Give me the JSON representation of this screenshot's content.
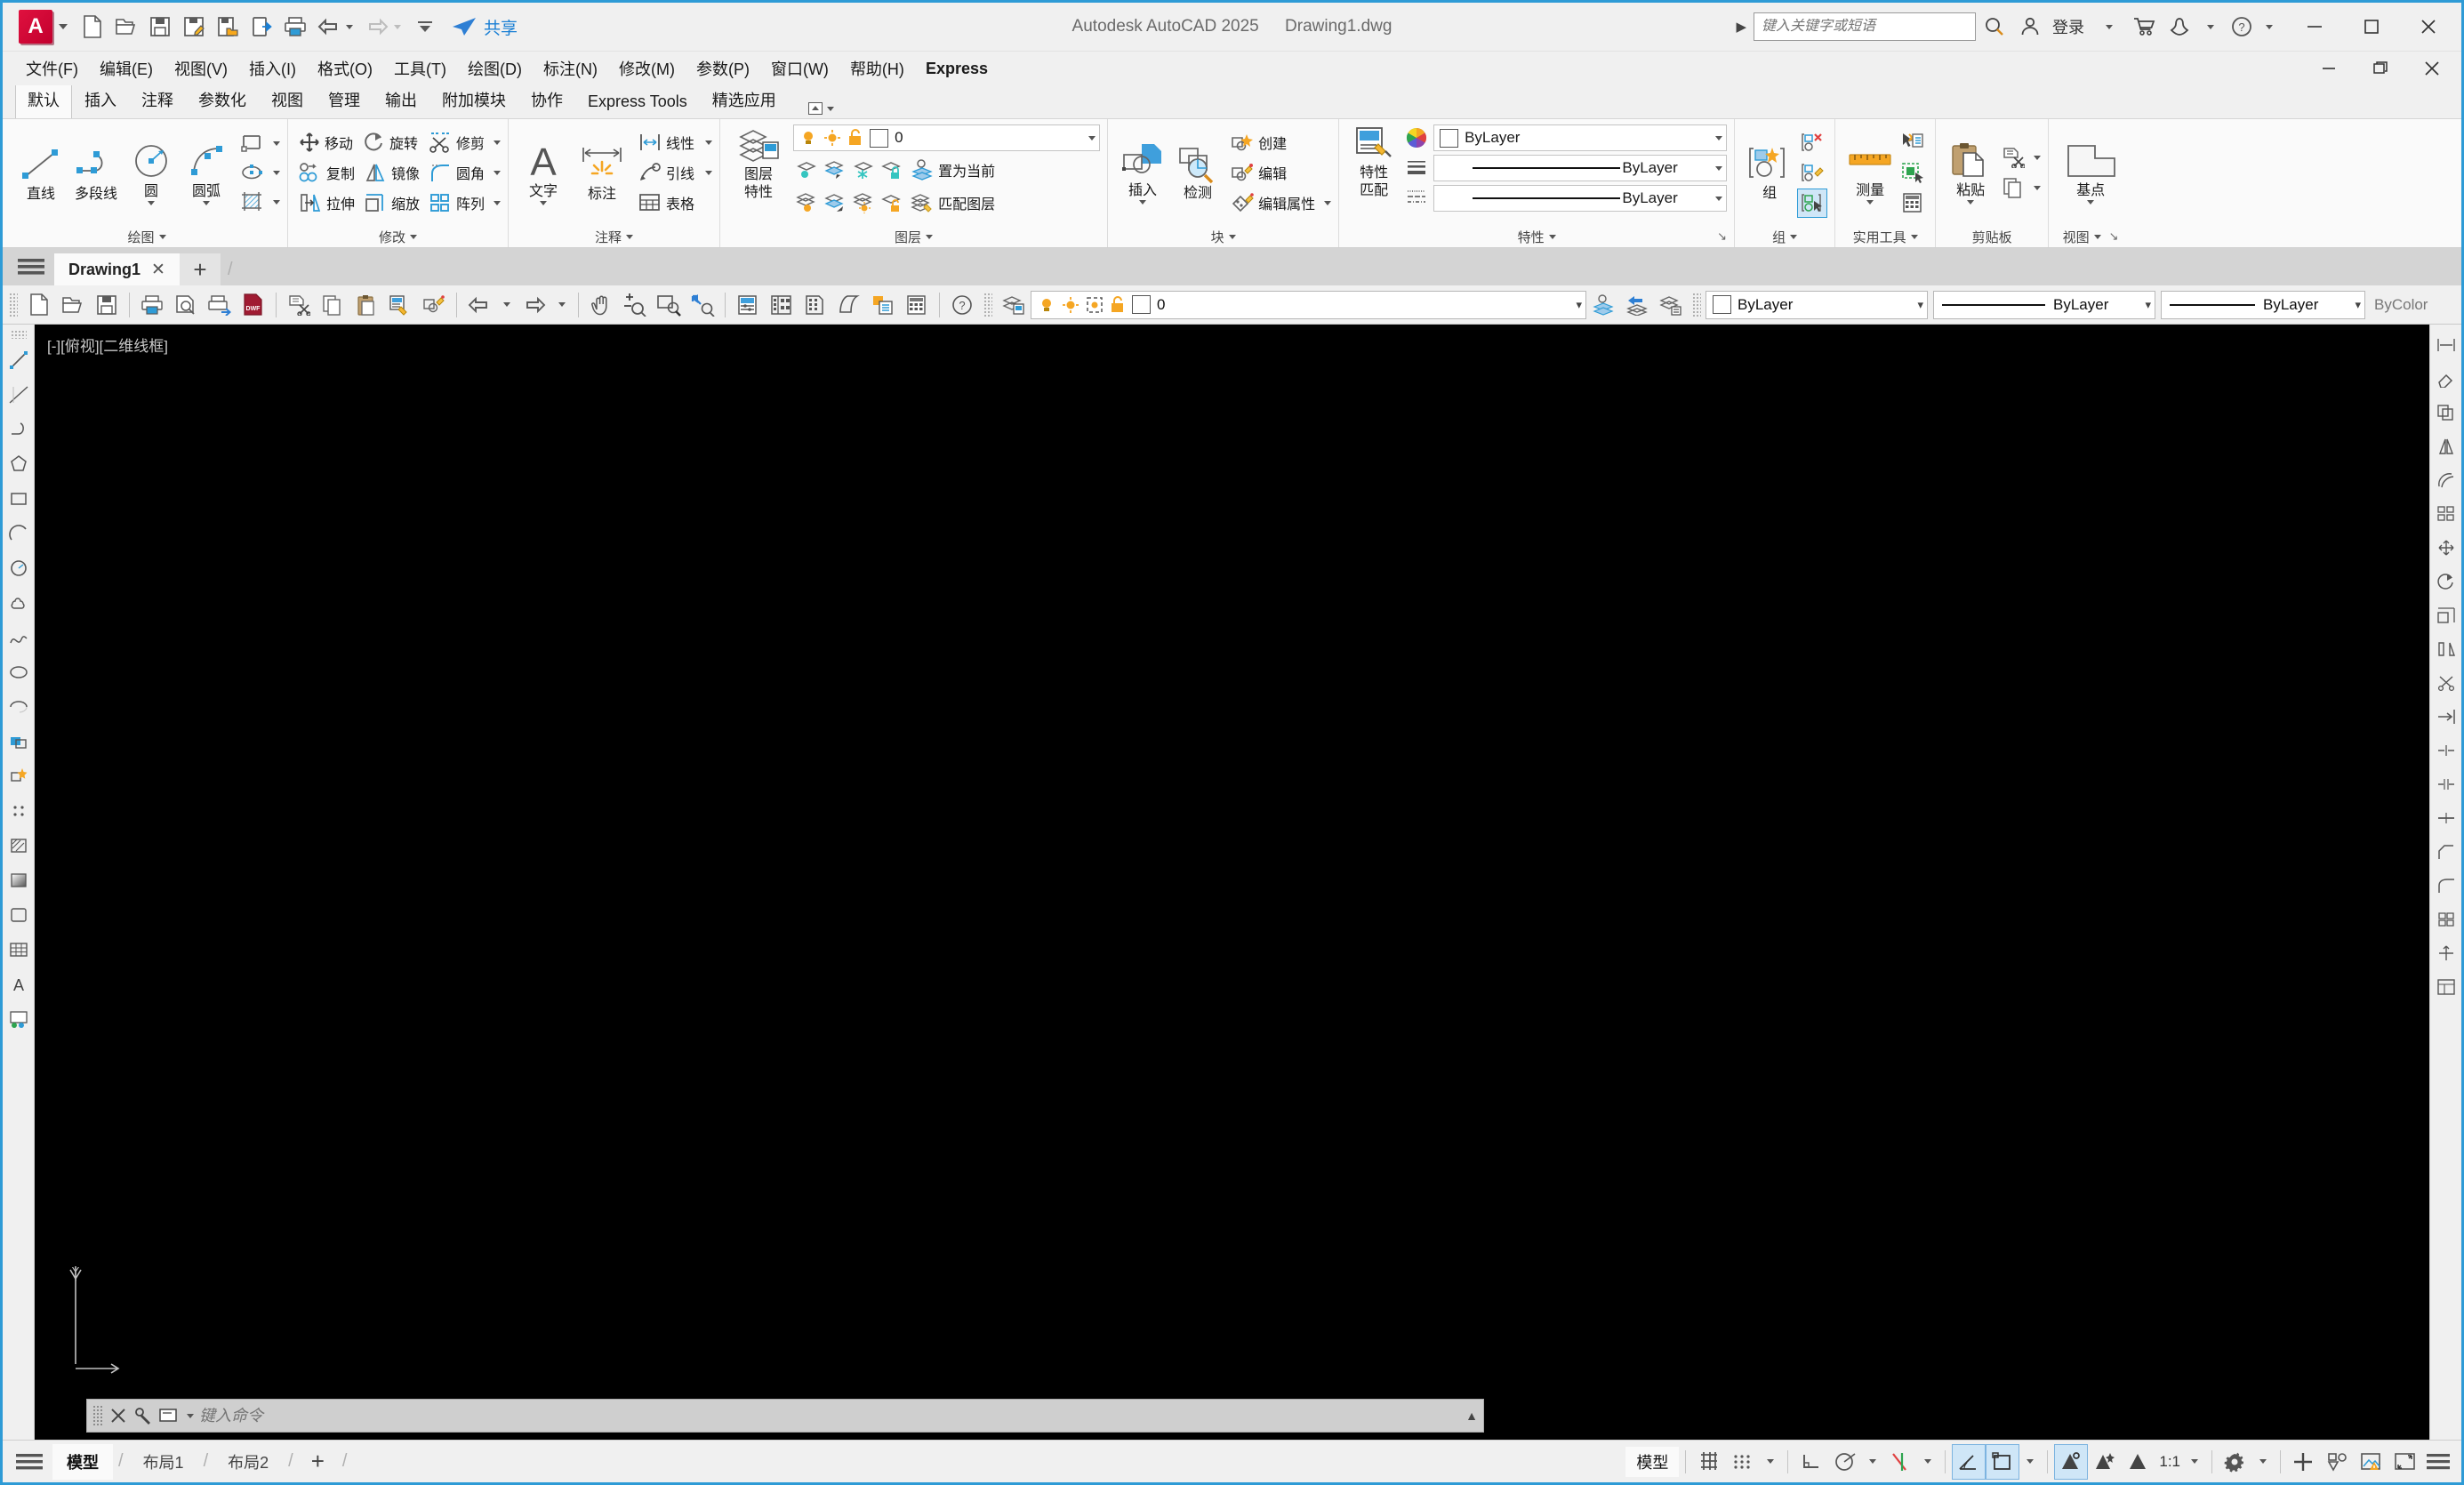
{
  "titlebar": {
    "app_logo": "A",
    "quick_access": [
      {
        "name": "new-file",
        "icon": "page"
      },
      {
        "name": "open-file",
        "icon": "folder-open"
      },
      {
        "name": "save",
        "icon": "save"
      },
      {
        "name": "save-as",
        "icon": "save-edit"
      },
      {
        "name": "save-to-cloud",
        "icon": "save-folder"
      },
      {
        "name": "export",
        "icon": "device-arrow"
      },
      {
        "name": "print",
        "icon": "printer"
      },
      {
        "name": "undo",
        "icon": "undo-arrow"
      },
      {
        "name": "redo",
        "icon": "redo-arrow"
      },
      {
        "name": "qat-dropdown",
        "icon": "bar-caret"
      }
    ],
    "share_label": "共享",
    "app_title": "Autodesk AutoCAD 2025",
    "file_name": "Drawing1.dwg",
    "search_placeholder": "键入关键字或短语",
    "signin_label": "登录",
    "window_buttons": [
      "minimize",
      "maximize",
      "close"
    ]
  },
  "menubar": {
    "items": [
      {
        "label": "文件(F)",
        "name": "menu-file"
      },
      {
        "label": "编辑(E)",
        "name": "menu-edit"
      },
      {
        "label": "视图(V)",
        "name": "menu-view"
      },
      {
        "label": "插入(I)",
        "name": "menu-insert"
      },
      {
        "label": "格式(O)",
        "name": "menu-format"
      },
      {
        "label": "工具(T)",
        "name": "menu-tools"
      },
      {
        "label": "绘图(D)",
        "name": "menu-draw"
      },
      {
        "label": "标注(N)",
        "name": "menu-dimension"
      },
      {
        "label": "修改(M)",
        "name": "menu-modify"
      },
      {
        "label": "参数(P)",
        "name": "menu-parametric"
      },
      {
        "label": "窗口(W)",
        "name": "menu-window"
      },
      {
        "label": "帮助(H)",
        "name": "menu-help"
      },
      {
        "label": "Express",
        "name": "menu-express"
      }
    ]
  },
  "ribbon_tabs": {
    "items": [
      {
        "label": "默认",
        "name": "ribbon-tab-home",
        "active": true
      },
      {
        "label": "插入",
        "name": "ribbon-tab-insert",
        "active": false
      },
      {
        "label": "注释",
        "name": "ribbon-tab-annotate",
        "active": false
      },
      {
        "label": "参数化",
        "name": "ribbon-tab-parametric",
        "active": false
      },
      {
        "label": "视图",
        "name": "ribbon-tab-view",
        "active": false
      },
      {
        "label": "管理",
        "name": "ribbon-tab-manage",
        "active": false
      },
      {
        "label": "输出",
        "name": "ribbon-tab-output",
        "active": false
      },
      {
        "label": "附加模块",
        "name": "ribbon-tab-addins",
        "active": false
      },
      {
        "label": "协作",
        "name": "ribbon-tab-collaborate",
        "active": false
      },
      {
        "label": "Express Tools",
        "name": "ribbon-tab-express-tools",
        "active": false
      },
      {
        "label": "精选应用",
        "name": "ribbon-tab-featured-apps",
        "active": false
      }
    ]
  },
  "ribbon": {
    "draw": {
      "title": "绘图",
      "line": "直线",
      "polyline": "多段线",
      "circle": "圆",
      "arc": "圆弧",
      "rectangle_icon": "rectangle-icon",
      "ellipse_icon": "ellipse-icon",
      "hatch_icon": "hatch-icon"
    },
    "modify": {
      "title": "修改",
      "move": "移动",
      "rotate": "旋转",
      "trim": "修剪",
      "copy": "复制",
      "mirror": "镜像",
      "fillet": "圆角",
      "stretch": "拉伸",
      "scale": "缩放",
      "array": "阵列"
    },
    "annotation": {
      "title": "注释",
      "text": "文字",
      "dimension": "标注",
      "linear": "线性",
      "leader": "引线",
      "table": "表格"
    },
    "layers": {
      "title": "图层",
      "layer_properties": "图层\n特性",
      "layer_properties_line1": "图层",
      "layer_properties_line2": "特性",
      "current_layer": "0",
      "set_current": "置为当前",
      "match_layer": "匹配图层"
    },
    "block": {
      "title": "块",
      "insert": "插入",
      "detect": "检测",
      "create": "创建",
      "edit": "编辑",
      "edit_attributes": "编辑属性"
    },
    "properties": {
      "title": "特性",
      "match_properties_line1": "特性",
      "match_properties_line2": "匹配",
      "color": "ByLayer",
      "lineweight": "ByLayer",
      "linetype": "ByLayer"
    },
    "groups": {
      "title": "组",
      "group": "组"
    },
    "utilities": {
      "title": "实用工具",
      "measure": "测量"
    },
    "clipboard": {
      "title": "剪贴板",
      "paste": "粘贴"
    },
    "view": {
      "title": "视图",
      "base": "基点"
    }
  },
  "doctabs": {
    "tabs": [
      {
        "label": "Drawing1",
        "close": "✕",
        "active": true
      }
    ],
    "add_label": "+"
  },
  "toolbar2": {
    "layer_value": "0",
    "color_value": "ByLayer",
    "lineweight_value": "ByLayer",
    "linetype_value": "ByLayer",
    "plotstyle_value": "ByColor"
  },
  "canvas": {
    "viewport_label": "[-][俯视][二维线框]",
    "background_color": "#000000",
    "ucs_axis": "Y"
  },
  "command": {
    "placeholder": "键入命令"
  },
  "statusbar": {
    "layout_tabs": [
      {
        "label": "模型",
        "name": "layout-tab-model",
        "active": true
      },
      {
        "label": "布局1",
        "name": "layout-tab-layout1",
        "active": false
      },
      {
        "label": "布局2",
        "name": "layout-tab-layout2",
        "active": false
      }
    ],
    "add_layout": "+",
    "model_button": "模型",
    "scale": "1:1",
    "right_buttons": [
      {
        "name": "grid-display",
        "icon": "grid-icon",
        "on": false
      },
      {
        "name": "snap-mode",
        "icon": "snap-dots-icon",
        "on": false
      },
      {
        "name": "ortho-mode",
        "icon": "ortho-icon",
        "on": false
      },
      {
        "name": "polar-tracking",
        "icon": "polar-icon",
        "on": false
      },
      {
        "name": "object-snap-tracking",
        "icon": "osnap-track-icon",
        "on": false
      },
      {
        "name": "lineweight-display",
        "icon": "angle-icon",
        "on": true
      },
      {
        "name": "transparency-display",
        "icon": "square-icon",
        "on": true
      },
      {
        "name": "selection-cycling",
        "icon": "cycle-icon",
        "on": true
      },
      {
        "name": "annotation-visibility",
        "icon": "anno-vis-icon",
        "on": false
      },
      {
        "name": "auto-scale",
        "icon": "anno-scale-icon",
        "on": false
      },
      {
        "name": "workspace-switch",
        "icon": "gear-icon",
        "on": false
      },
      {
        "name": "fullscreen",
        "icon": "plus-icon",
        "on": false
      },
      {
        "name": "isolate-objects",
        "icon": "isolate-icon",
        "on": false
      },
      {
        "name": "hardware-accel",
        "icon": "warn-image-icon",
        "on": false
      },
      {
        "name": "clean-screen",
        "icon": "expand-icon",
        "on": false
      },
      {
        "name": "customization",
        "icon": "hamburger-icon",
        "on": false
      }
    ]
  }
}
